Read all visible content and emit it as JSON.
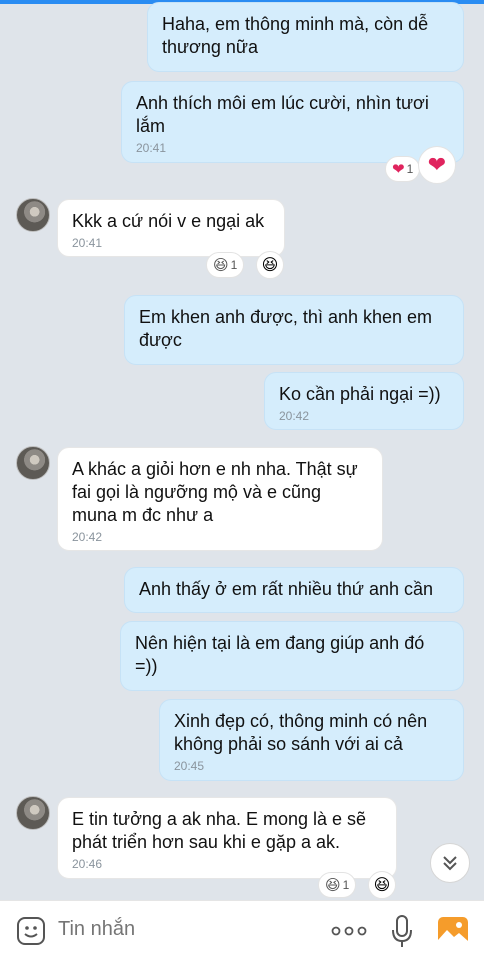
{
  "messages": [
    {
      "side": "me",
      "text": "Haha, em thông minh mà, còn dễ thương nữa",
      "time": ""
    },
    {
      "side": "me",
      "text": "Anh thích môi em lúc cười, nhìn tươi lắm",
      "time": "20:41",
      "reaction_count": "1"
    },
    {
      "side": "them",
      "text": "Kkk a cứ nói v e ngại ak",
      "time": "20:41",
      "reaction_count": "1"
    },
    {
      "side": "me",
      "text": "Em khen anh được, thì anh khen em được",
      "time": ""
    },
    {
      "side": "me",
      "text": "Ko cần phải ngại =))",
      "time": "20:42"
    },
    {
      "side": "them",
      "text": "A khác a giỏi hơn e nh nha. Thật sự fai gọi là ngưỡng mộ và e cũng muna m đc như a",
      "time": "20:42"
    },
    {
      "side": "me",
      "text": "Anh thấy ở em rất nhiều thứ anh cần",
      "time": ""
    },
    {
      "side": "me",
      "text": "Nên hiện tại là em đang giúp anh đó =))",
      "time": ""
    },
    {
      "side": "me",
      "text": "Xinh đẹp có, thông minh có nên không phải so sánh với ai cả",
      "time": "20:45"
    },
    {
      "side": "them",
      "text": "E tin tưởng a ak nha. E mong là e sẽ phát triển hơn sau khi e gặp a ak.",
      "time": "20:46",
      "reaction_count": "1"
    }
  ],
  "composer": {
    "placeholder": "Tin nhắn"
  },
  "icons": {
    "heart": "heart-icon",
    "laugh": "laugh-emoji-icon",
    "scroll": "chevron-double-down-icon",
    "sticker": "sticker-icon",
    "more": "more-dots-icon",
    "mic": "microphone-icon",
    "gallery": "gallery-icon"
  },
  "colors": {
    "accent": "#2a8cf2",
    "bubble_me": "#d5edfc",
    "bubble_them": "#ffffff",
    "background": "#dfe4ea"
  }
}
